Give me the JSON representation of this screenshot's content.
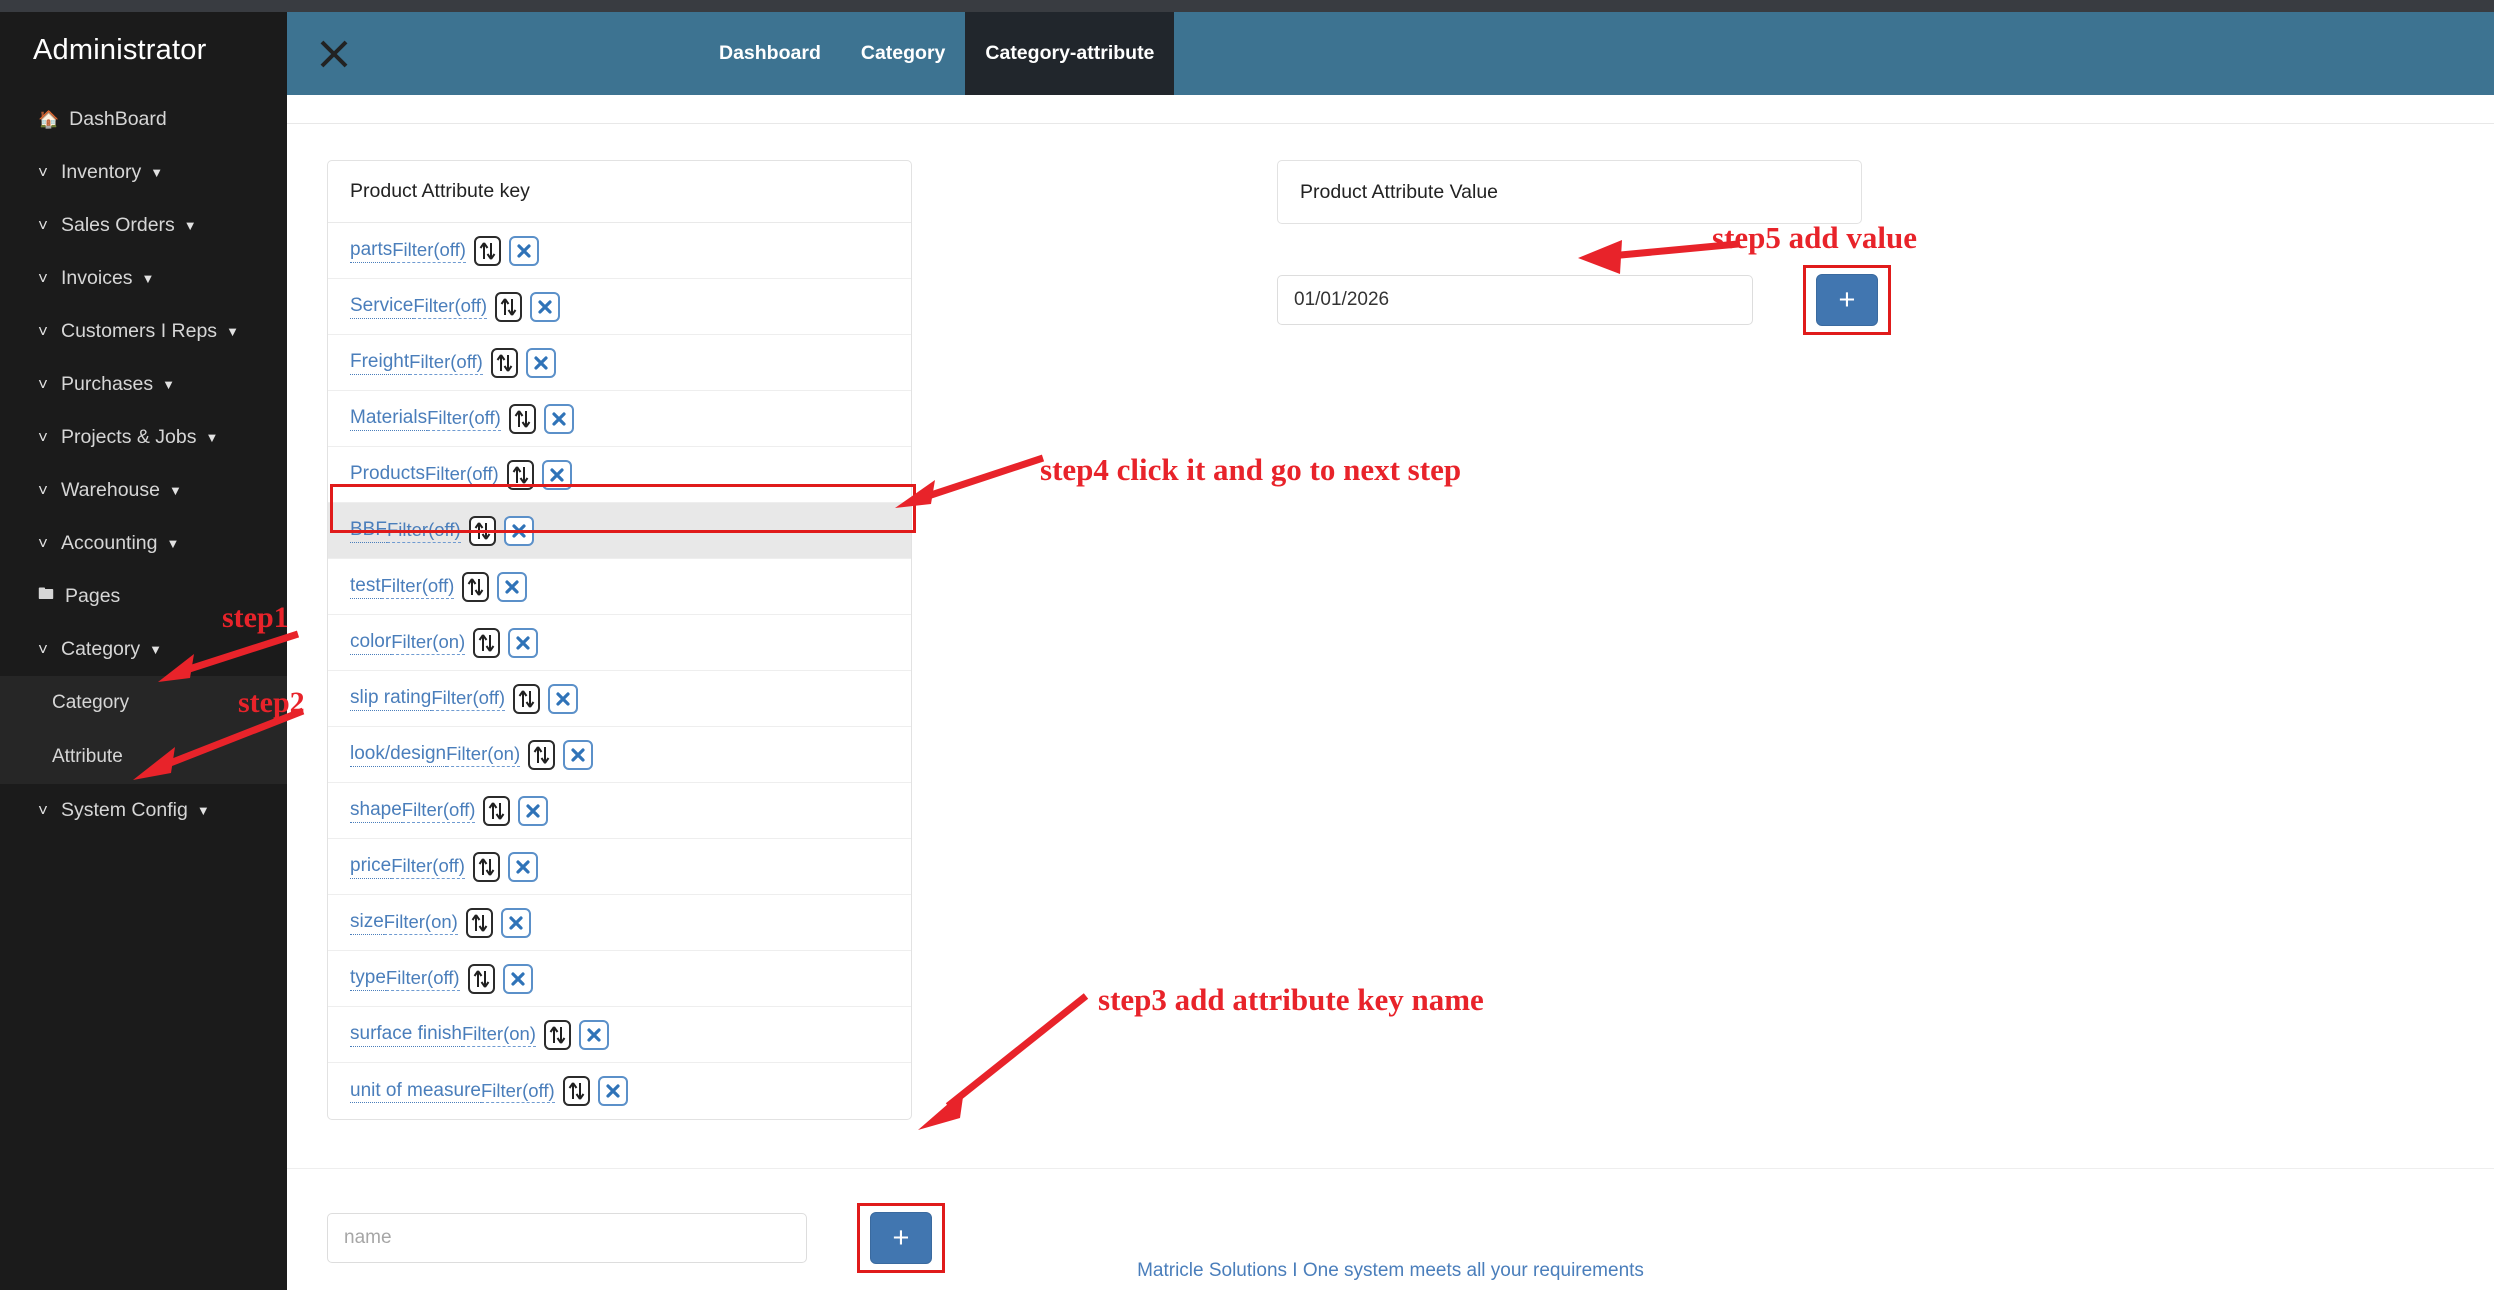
{
  "sidebar": {
    "brand": "Administrator",
    "items": [
      {
        "label": "DashBoard",
        "icon": "home-icon",
        "chevron": false,
        "caret": false
      },
      {
        "label": "Inventory",
        "icon": "chevron-icon",
        "chevron": true,
        "caret": true
      },
      {
        "label": "Sales Orders",
        "icon": "chevron-icon",
        "chevron": true,
        "caret": true
      },
      {
        "label": "Invoices",
        "icon": "chevron-icon",
        "chevron": true,
        "caret": true
      },
      {
        "label": "Customers I Reps",
        "icon": "chevron-icon",
        "chevron": true,
        "caret": true
      },
      {
        "label": "Purchases",
        "icon": "chevron-icon",
        "chevron": true,
        "caret": true
      },
      {
        "label": "Projects & Jobs",
        "icon": "chevron-icon",
        "chevron": true,
        "caret": true
      },
      {
        "label": "Warehouse",
        "icon": "chevron-icon",
        "chevron": true,
        "caret": true
      },
      {
        "label": "Accounting",
        "icon": "chevron-icon",
        "chevron": true,
        "caret": true
      },
      {
        "label": "Pages",
        "icon": "folder-icon",
        "chevron": false,
        "caret": false
      },
      {
        "label": "Category",
        "icon": "chevron-icon",
        "chevron": true,
        "caret": true
      }
    ],
    "submenu": [
      {
        "label": "Category"
      },
      {
        "label": "Attribute"
      }
    ],
    "items_after": [
      {
        "label": "System Config",
        "icon": "chevron-icon",
        "chevron": true,
        "caret": true
      }
    ]
  },
  "header": {
    "close_icon": "close-icon",
    "tabs": [
      {
        "label": "Dashboard",
        "active": false
      },
      {
        "label": "Category",
        "active": false
      },
      {
        "label": "Category-attribute",
        "active": true
      }
    ],
    "bar_color": "#3d7391",
    "active_tab_color": "#21262c"
  },
  "key_panel": {
    "title": "Product Attribute key",
    "rows": [
      {
        "name": "parts",
        "filter": "Filter(off)",
        "selected": false
      },
      {
        "name": "Service",
        "filter": "Filter(off)",
        "selected": false
      },
      {
        "name": "Freight",
        "filter": "Filter(off)",
        "selected": false
      },
      {
        "name": "Materials",
        "filter": "Filter(off)",
        "selected": false
      },
      {
        "name": "Products",
        "filter": "Filter(off)",
        "selected": false
      },
      {
        "name": "BBF",
        "filter": "Filter(off)",
        "selected": true
      },
      {
        "name": "test",
        "filter": "Filter(off)",
        "selected": false
      },
      {
        "name": "color",
        "filter": "Filter(on)",
        "selected": false
      },
      {
        "name": "slip rating",
        "filter": "Filter(off)",
        "selected": false
      },
      {
        "name": "look/design",
        "filter": "Filter(on)",
        "selected": false
      },
      {
        "name": "shape",
        "filter": "Filter(off)",
        "selected": false
      },
      {
        "name": "price",
        "filter": "Filter(off)",
        "selected": false
      },
      {
        "name": "size",
        "filter": "Filter(on)",
        "selected": false
      },
      {
        "name": "type",
        "filter": "Filter(off)",
        "selected": false
      },
      {
        "name": "surface finish",
        "filter": "Filter(on)",
        "selected": false
      },
      {
        "name": "unit of measure",
        "filter": "Filter(off)",
        "selected": false
      }
    ],
    "sort_icon": "sort-updown-icon",
    "delete_icon": "close-x-icon",
    "add": {
      "placeholder": "name",
      "value": "",
      "button_label": "+",
      "button_icon": "plus-icon"
    }
  },
  "value_panel": {
    "title": "Product Attribute Value",
    "add": {
      "value": "01/01/2026",
      "placeholder": "",
      "button_label": "+",
      "button_icon": "plus-icon"
    }
  },
  "footer": {
    "text": "Matricle Solutions I One system meets all your requirements"
  },
  "annotations": {
    "color": "#e8232a",
    "items": [
      {
        "id": "step1",
        "text": "step1"
      },
      {
        "id": "step2",
        "text": "step2"
      },
      {
        "id": "step3",
        "text": "step3 add attribute key name"
      },
      {
        "id": "step4",
        "text": "step4 click it and go to next step"
      },
      {
        "id": "step5",
        "text": "step5 add value"
      }
    ]
  }
}
